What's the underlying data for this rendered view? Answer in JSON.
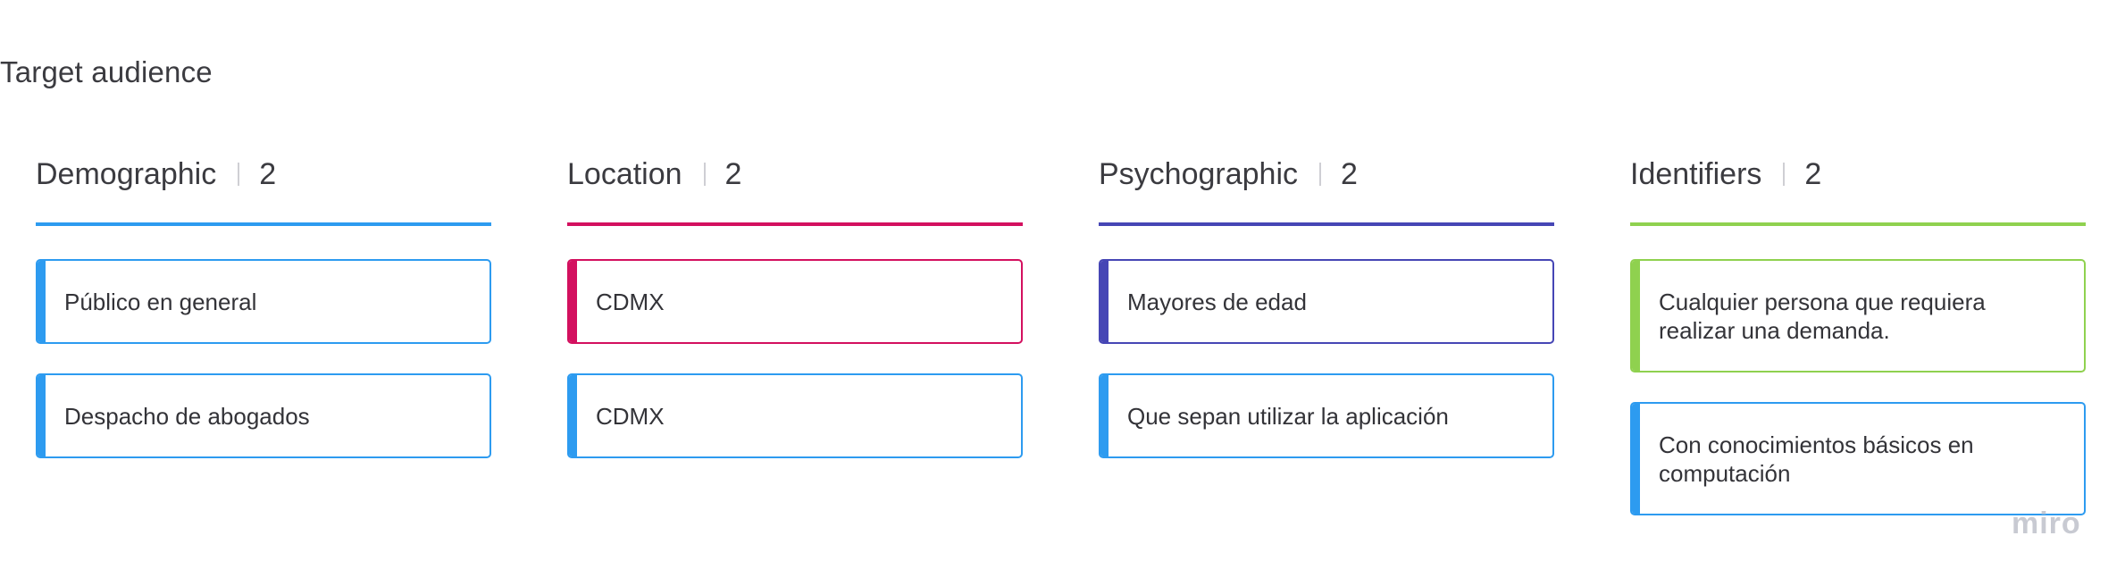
{
  "title": "Target audience",
  "columns": [
    {
      "name": "Demographic",
      "count": "2",
      "color": "#2d9bf0",
      "cards": [
        {
          "text": "Público en general",
          "color": "#2d9bf0"
        },
        {
          "text": "Despacho de abogados",
          "color": "#2d9bf0"
        }
      ]
    },
    {
      "name": "Location",
      "count": "2",
      "color": "#d3105f",
      "cards": [
        {
          "text": "CDMX",
          "color": "#d3105f"
        },
        {
          "text": "CDMX",
          "color": "#2d9bf0"
        }
      ]
    },
    {
      "name": "Psychographic",
      "count": "2",
      "color": "#4646b5",
      "cards": [
        {
          "text": "Mayores de edad",
          "color": "#4646b5"
        },
        {
          "text": "Que sepan utilizar la aplicación",
          "color": "#2d9bf0"
        }
      ]
    },
    {
      "name": "Identifiers",
      "count": "2",
      "color": "#8fd14f",
      "cards": [
        {
          "text": "Cualquier persona que requiera realizar una demanda.",
          "color": "#8fd14f"
        },
        {
          "text": "Con conocimientos básicos en computación",
          "color": "#2d9bf0"
        }
      ]
    }
  ],
  "watermark": "miro"
}
